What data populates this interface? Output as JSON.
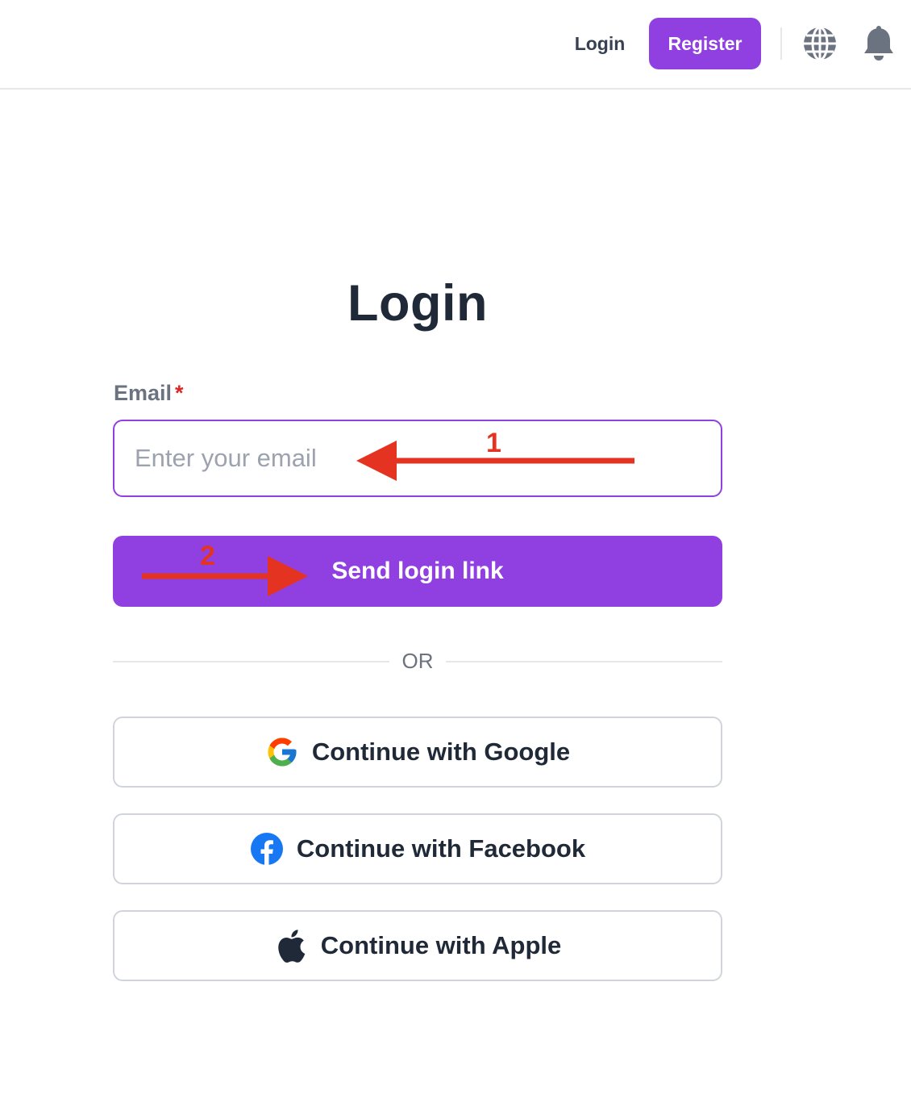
{
  "header": {
    "login_label": "Login",
    "register_label": "Register",
    "globe_icon": "globe-icon",
    "bell_icon": "bell-icon"
  },
  "form": {
    "title": "Login",
    "email_label": "Email",
    "required_marker": "*",
    "email_placeholder": "Enter your email",
    "email_value": "",
    "send_label": "Send login link",
    "or_label": "OR"
  },
  "social": {
    "google_label": "Continue with Google",
    "facebook_label": "Continue with Facebook",
    "apple_label": "Continue with Apple"
  },
  "annotations": {
    "step1": "1",
    "step2": "2",
    "arrow_color": "#e53322"
  },
  "colors": {
    "brand": "#9040e0",
    "required": "#dc2626"
  }
}
